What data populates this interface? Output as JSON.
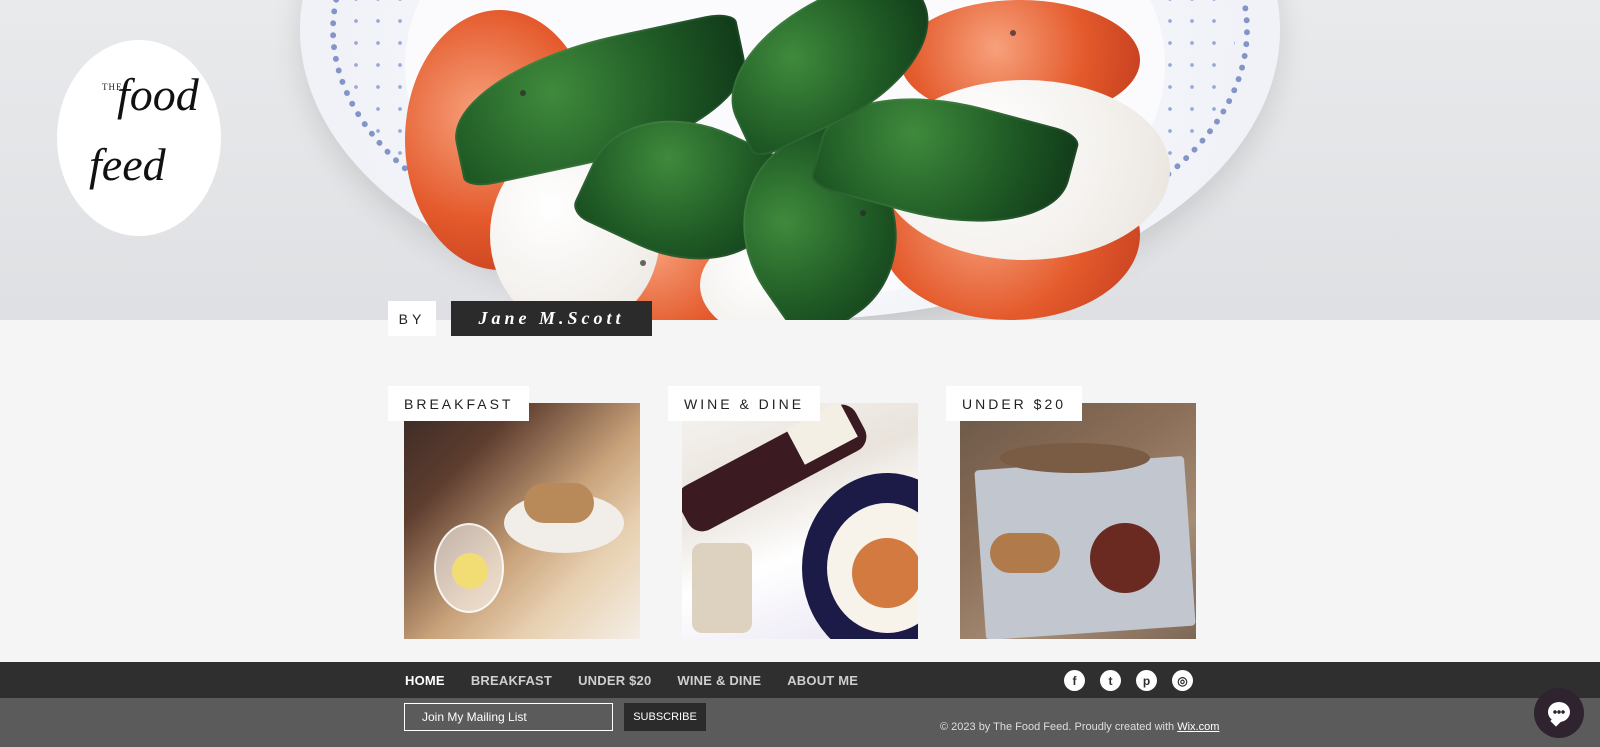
{
  "logo": {
    "the": "THE",
    "food": "food",
    "feed": "feed"
  },
  "byline": {
    "by": "BY",
    "author": "Jane M.Scott"
  },
  "categories": [
    {
      "label": "BREAKFAST"
    },
    {
      "label": "WINE & DINE"
    },
    {
      "label": "UNDER $20"
    }
  ],
  "footer_nav": {
    "items": [
      {
        "label": "HOME"
      },
      {
        "label": "BREAKFAST"
      },
      {
        "label": "UNDER $20"
      },
      {
        "label": "WINE & DINE"
      },
      {
        "label": "ABOUT ME"
      }
    ],
    "active_index": 0
  },
  "social_icons": [
    "facebook-icon",
    "twitter-icon",
    "pinterest-icon",
    "instagram-icon"
  ],
  "mailing": {
    "placeholder": "Join My Mailing List",
    "button_label": "SUBSCRIBE"
  },
  "copyright": {
    "text": "© 2023 by The Food Feed. Proudly created with",
    "link_text": "Wix.com"
  },
  "colors": {
    "dark": "#2b2b2b",
    "nav_bg": "#2f2f2f",
    "footer_bg": "#5b5b5b",
    "page_bg": "#f5f5f5"
  }
}
